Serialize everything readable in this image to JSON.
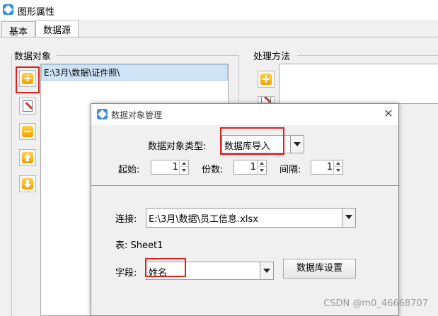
{
  "window": {
    "title": "图形属性"
  },
  "tabs": [
    {
      "label": "基本"
    },
    {
      "label": "数据源"
    }
  ],
  "data_object": {
    "group_label": "数据对象",
    "items": [
      "E:\\3月\\数据\\证件照\\"
    ],
    "buttons": [
      {
        "icon": "add-icon"
      },
      {
        "icon": "edit-icon"
      },
      {
        "icon": "remove-icon"
      },
      {
        "icon": "arrow-up-icon"
      },
      {
        "icon": "arrow-down-icon"
      }
    ]
  },
  "process": {
    "group_label": "处理方法",
    "buttons": [
      {
        "icon": "add-icon"
      },
      {
        "icon": "edit-icon"
      }
    ]
  },
  "dialog": {
    "title": "数据对象管理",
    "type_label": "数据对象类型:",
    "type_value": "数据库导入",
    "start_label": "起始:",
    "start_value": "1",
    "copies_label": "份数:",
    "copies_value": "1",
    "interval_label": "间隔:",
    "interval_value": "1",
    "connection_label": "连接:",
    "connection_value": "E:\\3月\\数据\\员工信息.xlsx",
    "table_text": "表: Sheet1",
    "field_label": "字段:",
    "field_value": "姓名",
    "db_settings_button": "数据库设置"
  },
  "watermark": "CSDN @m0_46668707",
  "colors": {
    "highlight": "#e0201c",
    "selection": "#cfe3f7",
    "accent": "#3b8fd9"
  }
}
